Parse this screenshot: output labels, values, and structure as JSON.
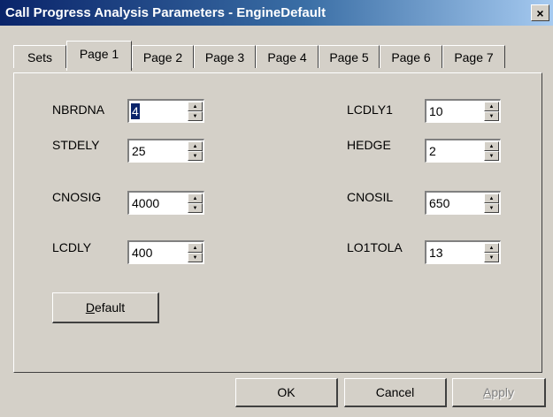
{
  "window": {
    "title": "Call Progress Analysis Parameters - EngineDefault",
    "close_glyph": "×"
  },
  "tabs": [
    {
      "label": "Sets",
      "active": false
    },
    {
      "label": "Page 1",
      "active": true
    },
    {
      "label": "Page 2",
      "active": false
    },
    {
      "label": "Page 3",
      "active": false
    },
    {
      "label": "Page 4",
      "active": false
    },
    {
      "label": "Page 5",
      "active": false
    },
    {
      "label": "Page 6",
      "active": false
    },
    {
      "label": "Page 7",
      "active": false
    }
  ],
  "fields": {
    "nbrdna": {
      "label": "NBRDNA",
      "value": "4"
    },
    "stdely": {
      "label": "STDELY",
      "value": "25"
    },
    "cnosig": {
      "label": "CNOSIG",
      "value": "4000"
    },
    "lcdly": {
      "label": "LCDLY",
      "value": "400"
    },
    "lcdly1": {
      "label": "LCDLY1",
      "value": "10"
    },
    "hedge": {
      "label": "HEDGE",
      "value": "2"
    },
    "cnosil": {
      "label": "CNOSIL",
      "value": "650"
    },
    "lo1tola": {
      "label": "LO1TOLA",
      "value": "13"
    }
  },
  "buttons": {
    "default": {
      "mnemonic": "D",
      "rest": "efault"
    },
    "ok": "OK",
    "cancel": "Cancel",
    "apply": {
      "mnemonic": "A",
      "rest": "pply"
    }
  },
  "icons": {
    "spin_up": "▲",
    "spin_down": "▼"
  }
}
